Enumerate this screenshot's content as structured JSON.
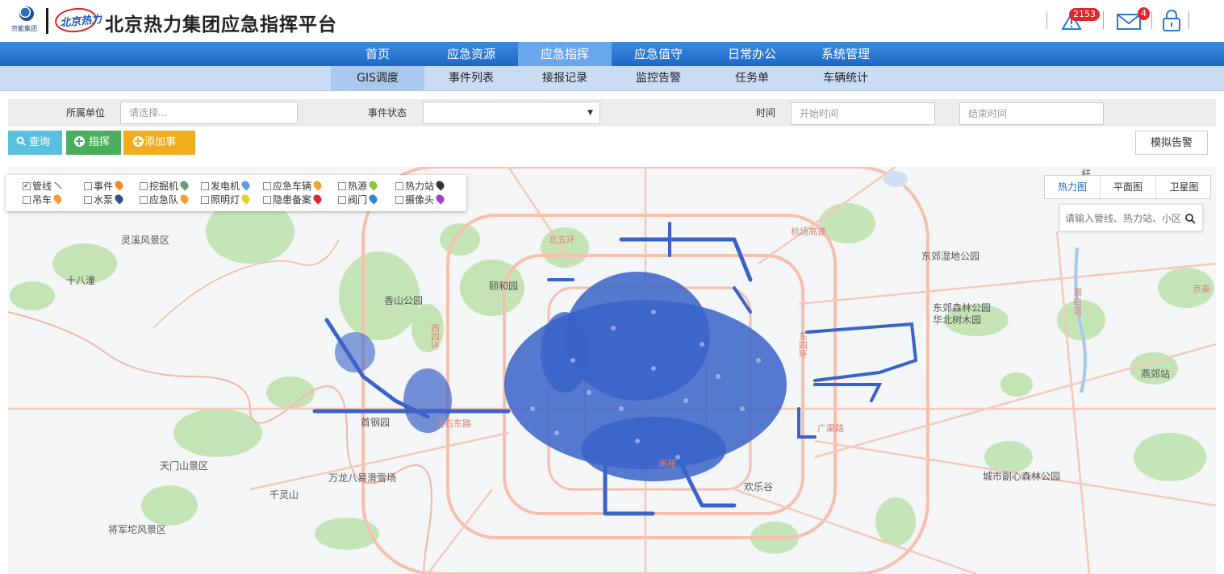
{
  "header": {
    "logo1_text": "京能集团",
    "logo2_text": "北京热力",
    "title": "北京热力集团应急指挥平台",
    "alert_count": "2153",
    "mail_count": "4"
  },
  "nav_primary": [
    {
      "label": "首页",
      "active": false
    },
    {
      "label": "应急资源",
      "active": false
    },
    {
      "label": "应急指挥",
      "active": true
    },
    {
      "label": "应急值守",
      "active": false
    },
    {
      "label": "日常办公",
      "active": false
    },
    {
      "label": "系统管理",
      "active": false
    }
  ],
  "nav_secondary": [
    {
      "label": "GIS调度",
      "active": true
    },
    {
      "label": "事件列表",
      "active": false
    },
    {
      "label": "接报记录",
      "active": false
    },
    {
      "label": "监控告警",
      "active": false
    },
    {
      "label": "任务单",
      "active": false
    },
    {
      "label": "车辆统计",
      "active": false
    }
  ],
  "filters": {
    "unit_label": "所属单位",
    "unit_placeholder": "请选择...",
    "status_label": "事件状态",
    "status_value": "",
    "time_label": "时间",
    "start_placeholder": "开始时间",
    "end_placeholder": "结束时间"
  },
  "actions": {
    "query": "查询",
    "command": "指挥",
    "add_event": "添加事件",
    "simulate_alarm": "模拟告警"
  },
  "layers": [
    {
      "label": "管线",
      "checked": true,
      "color": "#1f67c6"
    },
    {
      "label": "事件",
      "checked": false,
      "color": "#f08a24"
    },
    {
      "label": "挖掘机",
      "checked": false,
      "color": "#6d9b7a"
    },
    {
      "label": "发电机",
      "checked": false,
      "color": "#5aa0e6"
    },
    {
      "label": "应急车辆",
      "checked": false,
      "color": "#f0a030"
    },
    {
      "label": "热源",
      "checked": false,
      "color": "#8ac43a"
    },
    {
      "label": "热力站",
      "checked": false,
      "color": "#333333"
    },
    {
      "label": "吊车",
      "checked": false,
      "color": "#f0a030"
    },
    {
      "label": "水泵",
      "checked": false,
      "color": "#2d4f8a"
    },
    {
      "label": "应急队",
      "checked": false,
      "color": "#f0a030"
    },
    {
      "label": "照明灯",
      "checked": false,
      "color": "#e8d020"
    },
    {
      "label": "隐患备案",
      "checked": false,
      "color": "#d42a2a"
    },
    {
      "label": "阀门",
      "checked": false,
      "color": "#2a8ad4"
    },
    {
      "label": "摄像头",
      "checked": false,
      "color": "#a040d0"
    }
  ],
  "map_types": [
    {
      "label": "热力图",
      "active": true
    },
    {
      "label": "平面图",
      "active": false
    },
    {
      "label": "卫星图",
      "active": false
    }
  ],
  "map_search_placeholder": "请输入管线、热力站、小区",
  "map_labels": {
    "lingxi": "灵溪风景区",
    "shibadan": "十八潼",
    "xiangshan": "香山公园",
    "yiheyuan": "颐和园",
    "shougang": "首钢园",
    "tianmenshan": "天门山景区",
    "wanlong": "万龙八易滑雪场",
    "qianling": "千灵山",
    "jiangjuntuo": "将军坨风景区",
    "huanlegu": "欢乐谷",
    "dongjiao_shidi": "东郊湿地公园",
    "dongjiao_senlin": "东郊森林公园华北树木园",
    "yanjiao": "燕郊站",
    "chengshi_fuxin": "城市副心森林公园",
    "lianshi": "莲石东路",
    "jichang": "机场高速",
    "bei5": "北五环",
    "chaoyang": "潮白河",
    "jingqin": "京秦",
    "guangqu": "广渠路",
    "nanyuan": "南苑",
    "xihuan": "西四环",
    "donghuan": "东四环",
    "north": "杆"
  }
}
